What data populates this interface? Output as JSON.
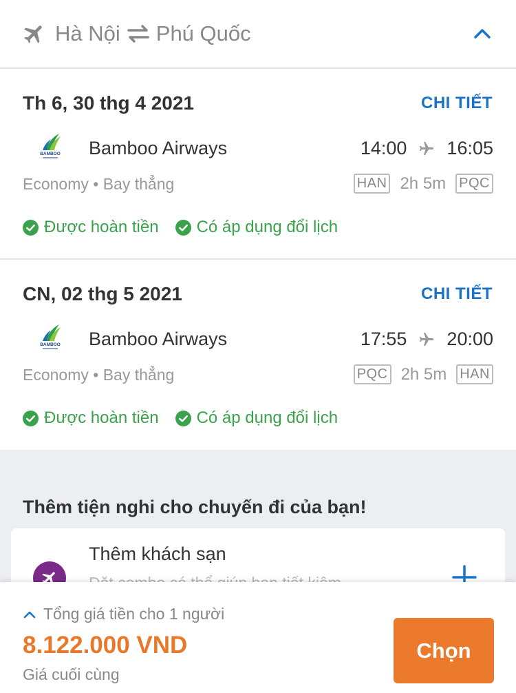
{
  "header": {
    "origin": "Hà Nội",
    "destination": "Phú Quốc"
  },
  "flights": [
    {
      "date": "Th 6, 30 thg 4 2021",
      "detail_label": "CHI TIẾT",
      "airline": "Bamboo Airways",
      "depart_time": "14:00",
      "arrive_time": "16:05",
      "cabin": "Economy",
      "stops": "Bay thẳng",
      "from_code": "HAN",
      "duration": "2h 5m",
      "to_code": "PQC",
      "badge1": "Được hoàn tiền",
      "badge2": "Có áp dụng đổi lịch"
    },
    {
      "date": "CN, 02 thg 5 2021",
      "detail_label": "CHI TIẾT",
      "airline": "Bamboo Airways",
      "depart_time": "17:55",
      "arrive_time": "20:00",
      "cabin": "Economy",
      "stops": "Bay thẳng",
      "from_code": "PQC",
      "duration": "2h 5m",
      "to_code": "HAN",
      "badge1": "Được hoàn tiền",
      "badge2": "Có áp dụng đổi lịch"
    }
  ],
  "extras": {
    "title": "Thêm tiện nghi cho chuyến đi của bạn!",
    "card_title": "Thêm khách sạn",
    "card_subtitle": "Đặt combo có thể giúp bạn tiết kiệm"
  },
  "footer": {
    "total_label": "Tổng giá tiền cho 1 người",
    "price": "8.122.000 VND",
    "final_label": "Giá cuối cùng",
    "choose_label": "Chọn"
  },
  "colors": {
    "accent_blue": "#1a73c8",
    "price_orange": "#e8782a",
    "button_orange": "#ec7a2c",
    "success_green": "#3aa24a",
    "hotel_icon_purple": "#7b2a8a"
  }
}
